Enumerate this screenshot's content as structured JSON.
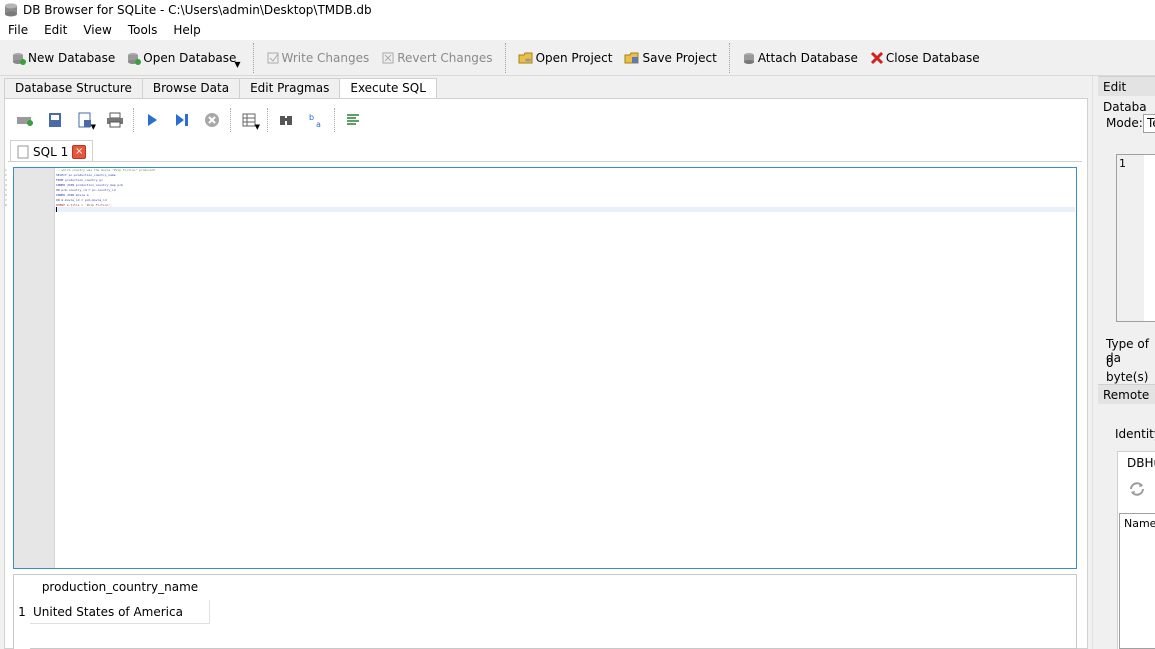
{
  "window": {
    "title": "DB Browser for SQLite - C:\\Users\\admin\\Desktop\\TMDB.db"
  },
  "menu": [
    "File",
    "Edit",
    "View",
    "Tools",
    "Help"
  ],
  "toolbar": {
    "new_db": "New Database",
    "open_db": "Open Database",
    "write_changes": "Write Changes",
    "revert_changes": "Revert Changes",
    "open_project": "Open Project",
    "save_project": "Save Project",
    "attach_db": "Attach Database",
    "close_db": "Close Database"
  },
  "tabs": [
    "Database Structure",
    "Browse Data",
    "Edit Pragmas",
    "Execute SQL"
  ],
  "active_tab": "Execute SQL",
  "sql_tab": {
    "label": "SQL 1",
    "close": "×"
  },
  "editor": {
    "line_numbers": [
      "1",
      "2",
      "3",
      "4",
      "5",
      "6",
      "7",
      "8"
    ],
    "lines": [
      "-- which country was the movie \"Pulp Fiction\" produced?",
      "SELECT pc.production_country_name",
      "FROM production_country pc",
      "INNER JOIN production_country_map pcm",
      "ON pcm.country_id = pc.country_id",
      "INNER JOIN movie m",
      "ON m.movie_id = pcm.movie_id",
      "WHERE m.title = 'Pulp Fiction';"
    ]
  },
  "results": {
    "columns": [
      "production_country_name"
    ],
    "rows": [
      {
        "num": "1",
        "cells": [
          "United States of America"
        ]
      }
    ]
  },
  "dock": {
    "edit_title": "Edit Databa",
    "mode_label": "Mode:",
    "mode_value": "Te",
    "value_line": "1",
    "type_label": "Type of da",
    "size_label": "0 byte(s)",
    "remote_title": "Remote",
    "identity_label": "Identity",
    "dbhub_tab": "DBHul",
    "name_header": "Name"
  }
}
